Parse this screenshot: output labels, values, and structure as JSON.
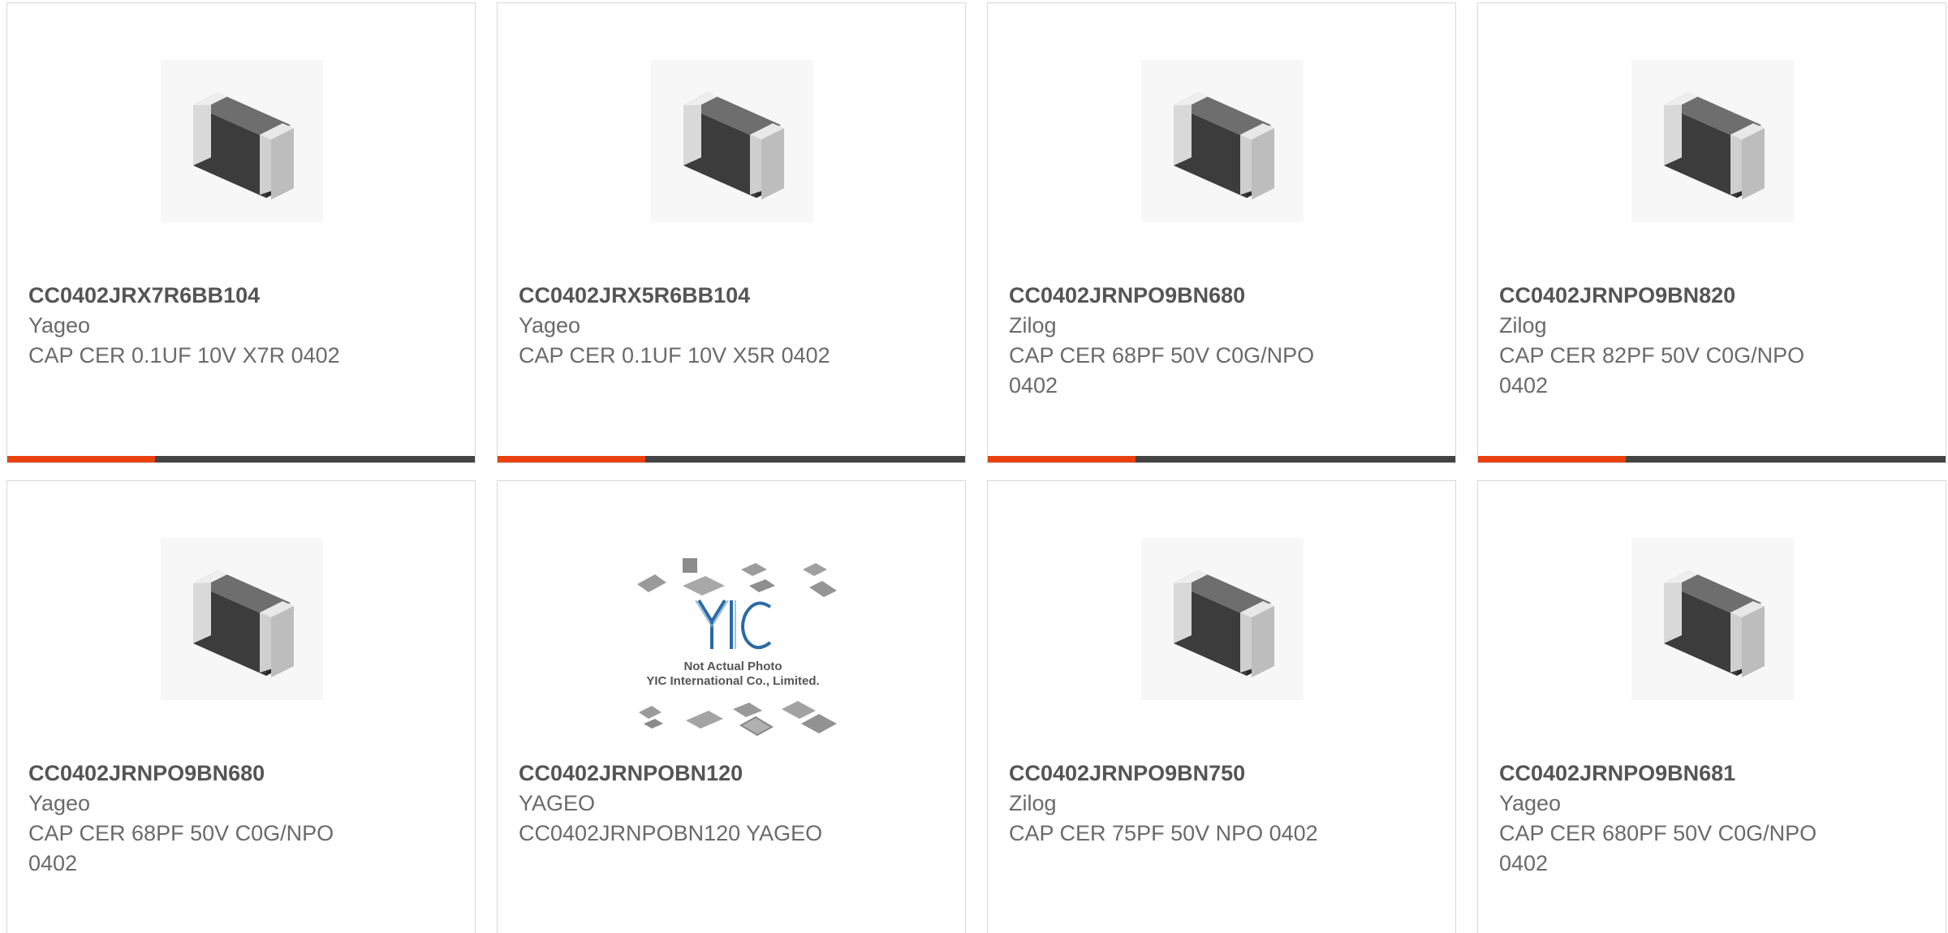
{
  "colors": {
    "accent": "#e8410f",
    "bar_dark": "#444444",
    "border": "#d8d8d8"
  },
  "products": [
    {
      "part": "CC0402JRX7R6BB104",
      "manufacturer": "Yageo",
      "description": "CAP CER 0.1UF 10V X7R 0402",
      "image": "smd-capacitor-chip"
    },
    {
      "part": "CC0402JRX5R6BB104",
      "manufacturer": "Yageo",
      "description": "CAP CER 0.1UF 10V X5R 0402",
      "image": "smd-capacitor-chip"
    },
    {
      "part": "CC0402JRNPO9BN680",
      "manufacturer": "Zilog",
      "description": "CAP CER 68PF 50V C0G/NPO 0402",
      "image": "smd-capacitor-chip"
    },
    {
      "part": "CC0402JRNPO9BN820",
      "manufacturer": "Zilog",
      "description": "CAP CER 82PF 50V C0G/NPO 0402",
      "image": "smd-capacitor-chip"
    },
    {
      "part": "CC0402JRNPO9BN680",
      "manufacturer": "Yageo",
      "description": "CAP CER 68PF 50V C0G/NPO 0402",
      "image": "smd-capacitor-chip"
    },
    {
      "part": "CC0402JRNPOBN120",
      "manufacturer": "YAGEO",
      "description": "CC0402JRNPOBN120 YAGEO",
      "image": "not-actual-photo-placeholder",
      "placeholder_line1": "Not Actual Photo",
      "placeholder_line2": "YIC International Co., Limited.",
      "placeholder_logo": "YIC"
    },
    {
      "part": "CC0402JRNPO9BN750",
      "manufacturer": "Zilog",
      "description": "CAP CER 75PF 50V NPO 0402",
      "image": "smd-capacitor-chip"
    },
    {
      "part": "CC0402JRNPO9BN681",
      "manufacturer": "Yageo",
      "description": "CAP CER 680PF 50V C0G/NPO 0402",
      "image": "smd-capacitor-chip"
    }
  ]
}
